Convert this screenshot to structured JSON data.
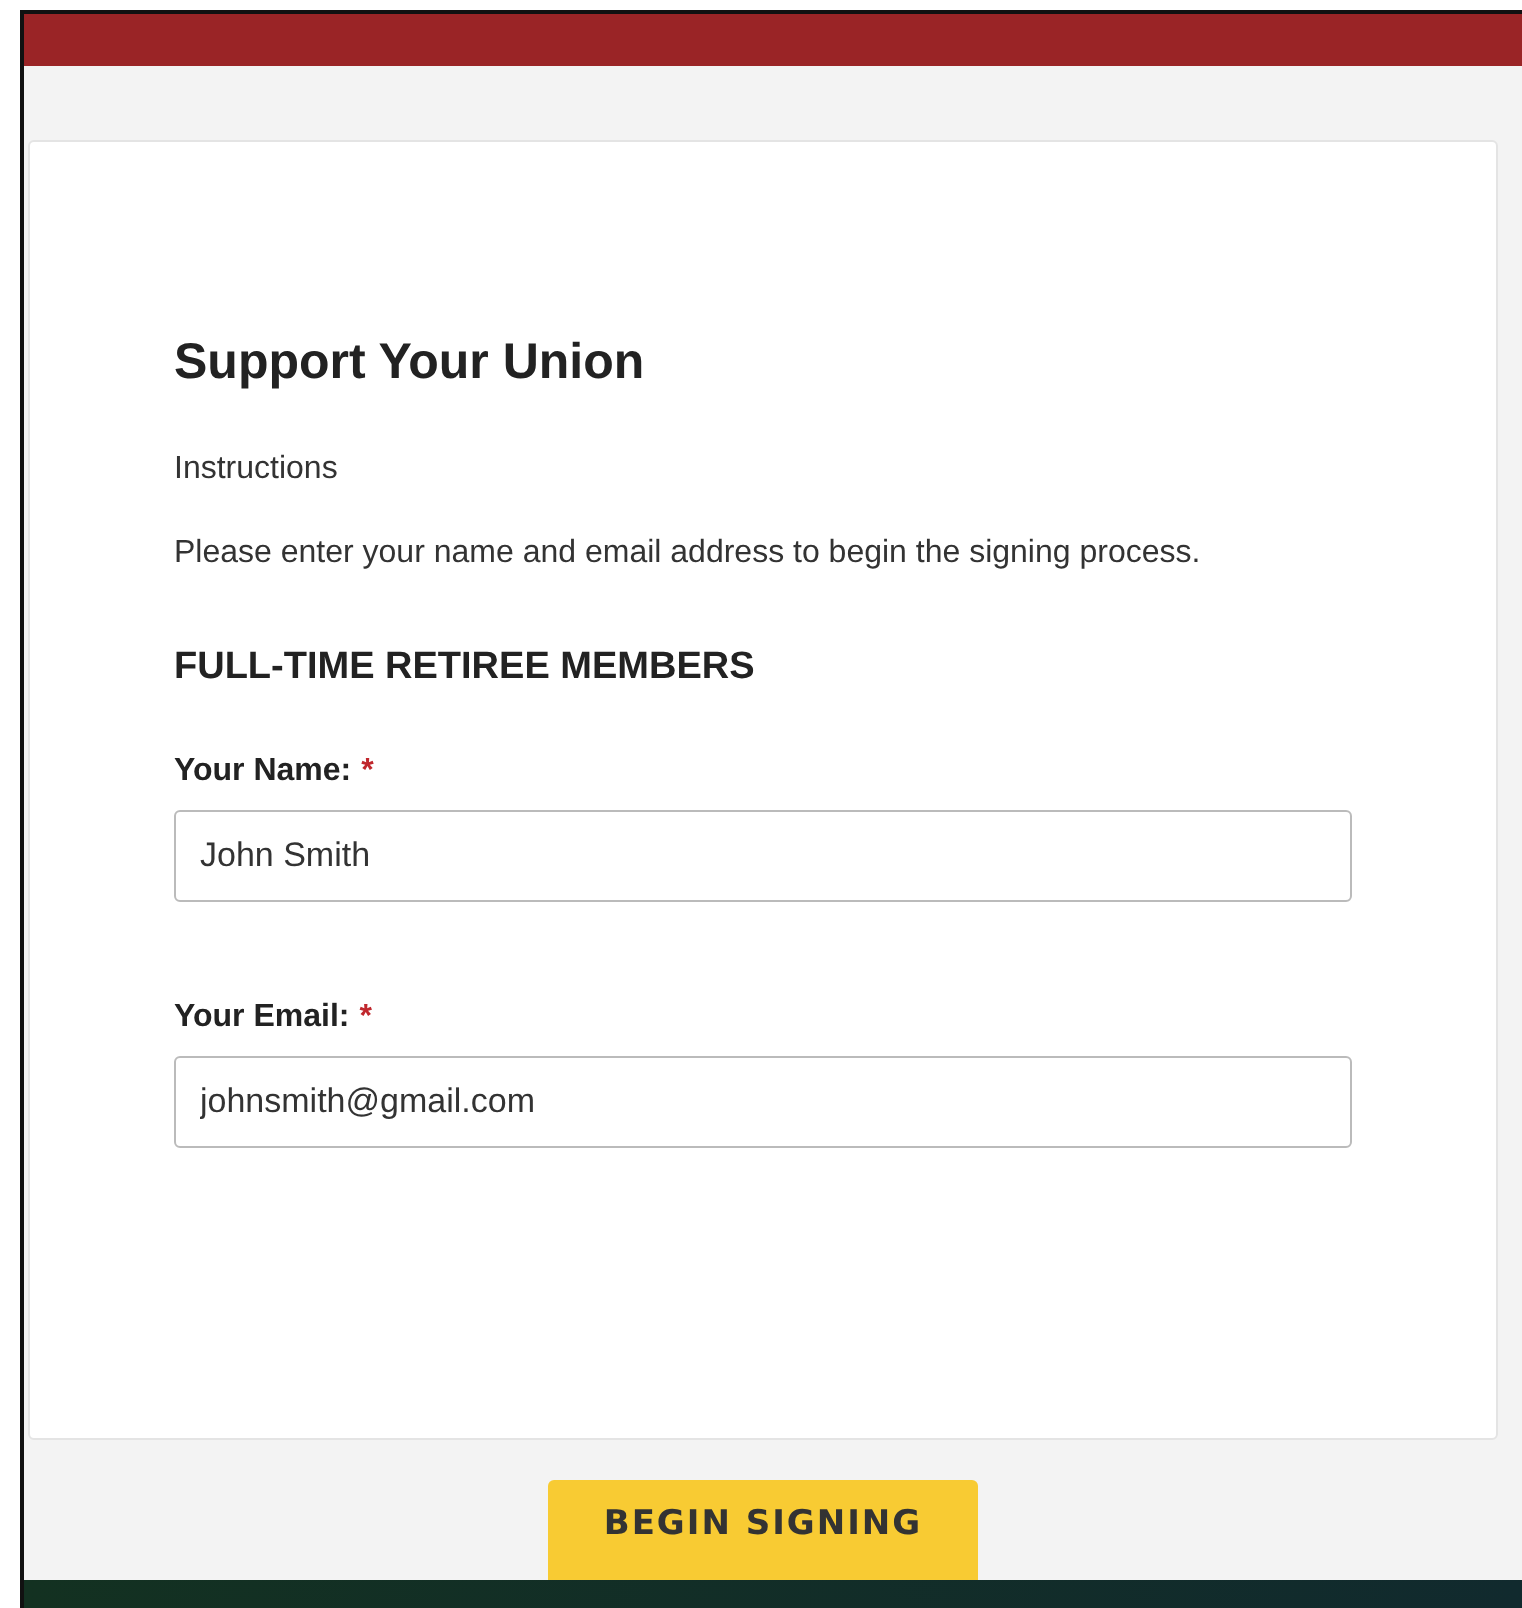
{
  "form": {
    "title": "Support Your Union",
    "instructions_label": "Instructions",
    "instructions": "Please enter your name and email address to begin the signing process.",
    "section": "FULL-TIME RETIREE MEMBERS",
    "fields": [
      {
        "label": "Your Name:",
        "required_mark": "*",
        "value": "John Smith"
      },
      {
        "label": "Your Email:",
        "required_mark": "*",
        "value": "johnsmith@gmail.com"
      }
    ]
  },
  "button": {
    "label": "BEGIN SIGNING"
  }
}
